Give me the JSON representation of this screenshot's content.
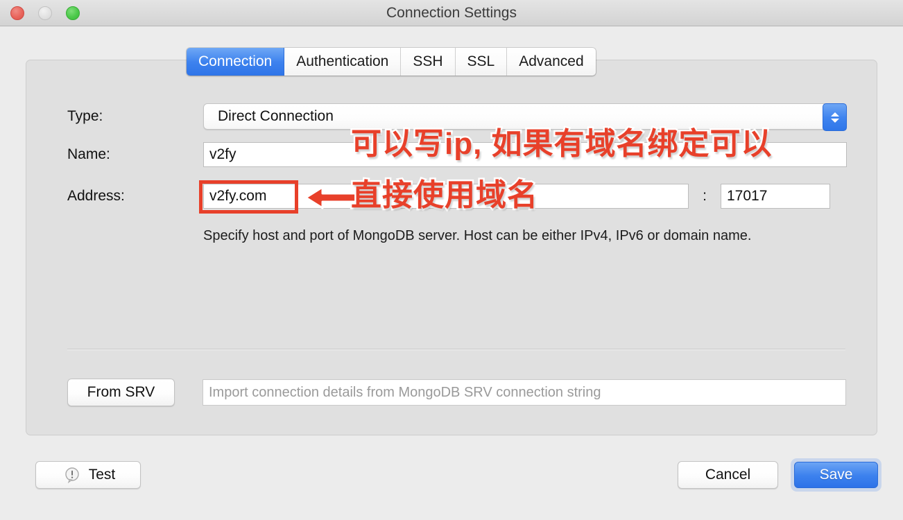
{
  "window": {
    "title": "Connection Settings",
    "traffic_lights": [
      "close",
      "minimize",
      "maximize"
    ]
  },
  "tabs": [
    {
      "label": "Connection",
      "active": true
    },
    {
      "label": "Authentication",
      "active": false
    },
    {
      "label": "SSH",
      "active": false
    },
    {
      "label": "SSL",
      "active": false
    },
    {
      "label": "Advanced",
      "active": false
    }
  ],
  "form": {
    "type_label": "Type:",
    "type_value": "Direct Connection",
    "name_label": "Name:",
    "name_value": "v2fy",
    "address_label": "Address:",
    "address_value": "v2fy.com",
    "port_separator": ":",
    "port_value": "17017",
    "help_text": "Specify host and port of MongoDB server. Host can be either IPv4, IPv6 or domain name."
  },
  "srv": {
    "button_label": "From SRV",
    "input_placeholder": "Import connection details from MongoDB SRV connection string",
    "input_value": ""
  },
  "footer": {
    "test_label": "Test",
    "cancel_label": "Cancel",
    "save_label": "Save"
  },
  "annotations": {
    "line1": "可以写ip, 如果有域名绑定可以",
    "line2": "直接使用域名",
    "color": "#e8402a",
    "highlight_target": "address-input"
  },
  "colors": {
    "accent_blue": "#3d82ee",
    "panel_bg": "#e0e0e0",
    "window_bg": "#ececec",
    "annotation_red": "#e8402a"
  }
}
